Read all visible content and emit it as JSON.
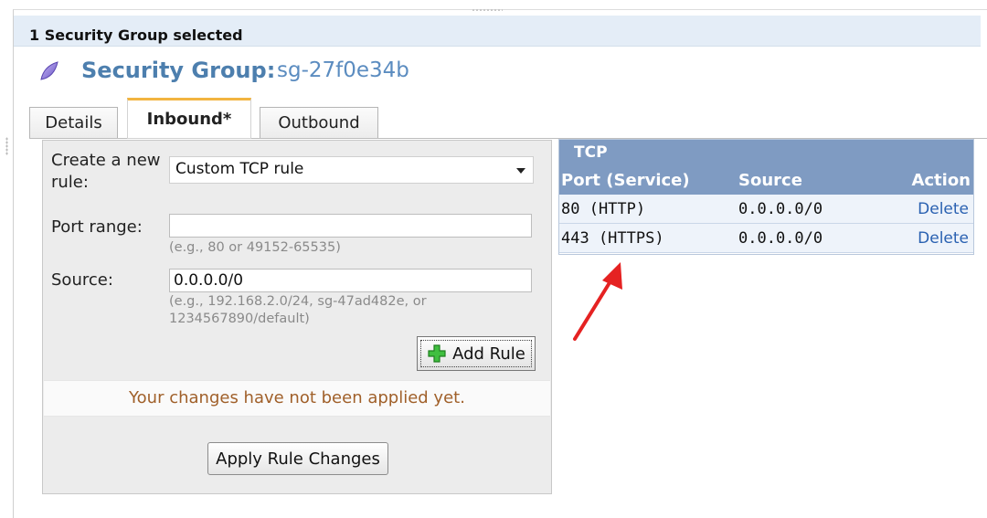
{
  "selection_bar": {
    "text": "1 Security Group selected"
  },
  "title": {
    "label": "Security Group:",
    "value": "sg-27f0e34b",
    "icon": "security-group-icon"
  },
  "tabs": [
    {
      "label": "Details",
      "active": false
    },
    {
      "label": "Inbound*",
      "active": true
    },
    {
      "label": "Outbound",
      "active": false
    }
  ],
  "form": {
    "create_label": "Create a new rule:",
    "rule_select_value": "Custom TCP rule",
    "port_label": "Port range:",
    "port_value": "",
    "port_hint": "(e.g., 80 or 49152-65535)",
    "source_label": "Source:",
    "source_value": "0.0.0.0/0",
    "source_hint": "(e.g., 192.168.2.0/24, sg-47ad482e, or 1234567890/default)",
    "add_rule_label": "Add Rule",
    "notice": "Your changes have not been applied yet.",
    "apply_label": "Apply Rule Changes"
  },
  "rules": {
    "group": "TCP",
    "columns": [
      "Port (Service)",
      "Source",
      "Action"
    ],
    "rows": [
      {
        "port": "80 (HTTP)",
        "source": "0.0.0.0/0",
        "action": "Delete"
      },
      {
        "port": "443 (HTTPS)",
        "source": "0.0.0.0/0",
        "action": "Delete"
      }
    ]
  },
  "colors": {
    "accent_title": "#4d7fae",
    "table_header": "#7f9bc2",
    "link": "#2a61b1",
    "notice": "#a0602a",
    "arrow": "#e52222",
    "tab_active": "#f2b440"
  }
}
